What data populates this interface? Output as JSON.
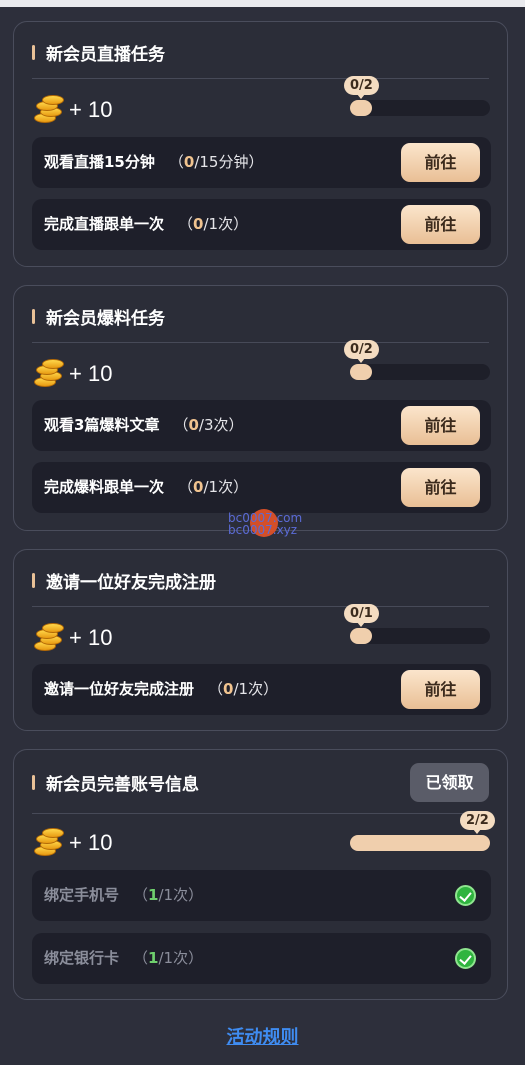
{
  "cards": [
    {
      "title": "新会员直播任务",
      "reward": "+ 10",
      "progress_label": "0/2",
      "progress_fraction": 0.0,
      "tasks": [
        {
          "name": "观看直播15分钟",
          "done_count": "0",
          "total": "/15分钟",
          "button": "前往"
        },
        {
          "name": "完成直播跟单一次",
          "done_count": "0",
          "total": "/1次",
          "button": "前往"
        }
      ]
    },
    {
      "title": "新会员爆料任务",
      "reward": "+ 10",
      "progress_label": "0/2",
      "progress_fraction": 0.0,
      "tasks": [
        {
          "name": "观看3篇爆料文章",
          "done_count": "0",
          "total": "/3次",
          "button": "前往"
        },
        {
          "name": "完成爆料跟单一次",
          "done_count": "0",
          "total": "/1次",
          "button": "前往"
        }
      ]
    },
    {
      "title": "邀请一位好友完成注册",
      "reward": "+ 10",
      "progress_label": "0/1",
      "progress_fraction": 0.0,
      "tasks": [
        {
          "name": "邀请一位好友完成注册",
          "done_count": "0",
          "total": "/1次",
          "button": "前往"
        }
      ]
    },
    {
      "title": "新会员完善账号信息",
      "claimed_label": "已领取",
      "reward": "+ 10",
      "progress_label": "2/2",
      "progress_fraction": 1.0,
      "tasks": [
        {
          "name": "绑定手机号",
          "done_count": "1",
          "total": "/1次",
          "status": "completed"
        },
        {
          "name": "绑定银行卡",
          "done_count": "1",
          "total": "/1次",
          "status": "completed"
        }
      ]
    }
  ],
  "watermark": {
    "line1": "bc0007.com",
    "line2": "bc0007.xyz"
  },
  "footer": {
    "rules_link": "活动规则"
  },
  "colors": {
    "background": "#2d2f3b",
    "accent": "#e9c197",
    "link": "#3f8cf1",
    "done": "#2fb43f"
  }
}
